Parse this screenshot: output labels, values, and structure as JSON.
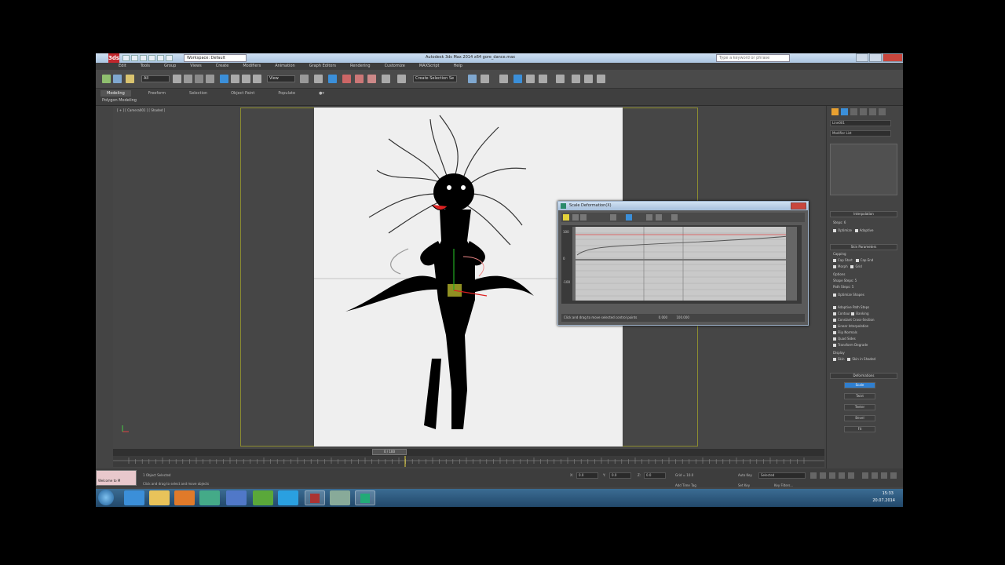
{
  "window": {
    "title": "Autodesk 3ds Max 2014 x64    gore_dance.max",
    "app_logo": "3ds",
    "workspace": "Workspace: Default",
    "search_placeholder": "Type a keyword or phrase"
  },
  "menus": [
    "Edit",
    "Tools",
    "Group",
    "Views",
    "Create",
    "Modifiers",
    "Animation",
    "Graph Editors",
    "Rendering",
    "Customize",
    "MAXScript",
    "Help"
  ],
  "toolbar": {
    "selection_filter": "All",
    "ref_coord": "View",
    "named_selection": "Create Selection Se"
  },
  "ribbon": {
    "tabs": [
      "Modeling",
      "Freeform",
      "Selection",
      "Object Paint",
      "Populate"
    ],
    "active_tab": "Modeling",
    "sub_label": "Polygon Modeling"
  },
  "viewport": {
    "label": "[ + ] [ Camera001 ] [ Shaded ]"
  },
  "dialog": {
    "title": "Scale Deformation(X)",
    "graph_ticks": [
      "100",
      "0",
      "-100"
    ],
    "status_text": "Click and drag to move selected control points",
    "status_value_1": "0.000",
    "status_value_2": "100.000"
  },
  "command_panel": {
    "object_name": "Line001",
    "modifier_list": "Modifier List",
    "rollout_interpolation": "Interpolation",
    "steps_label": "Steps:",
    "steps_value": "6",
    "optimize_label": "Optimize",
    "adaptive_label": "Adaptive",
    "path_steps_label": "Path Steps:",
    "rollout_skin": "Skin Parameters",
    "capping_label": "Capping",
    "cap_start": "Cap Start",
    "cap_end": "Cap End",
    "morph": "Morph",
    "grid": "Grid",
    "options_label": "Options",
    "shape_steps_label": "Shape Steps:",
    "shape_steps_value": "5",
    "path_steps2_label": "Path Steps:",
    "path_steps2_value": "5",
    "options": [
      "Optimize Shapes",
      "Adaptive Path Steps",
      "Contour",
      "Banking",
      "Constant Cross-Section",
      "Linear Interpolation",
      "Flip Normals",
      "Quad Sides",
      "Transform Degrade"
    ],
    "display_label": "Display",
    "skin": "Skin",
    "skin_shaded": "Skin in Shaded",
    "rollout_deform": "Deformations",
    "deform_buttons": [
      "Scale",
      "Twist",
      "Teeter",
      "Bevel",
      "Fit"
    ],
    "active_deform": "Scale"
  },
  "timeline": {
    "slider": "0 / 100"
  },
  "status": {
    "maxscript": "Welcome to M",
    "selection": "1 Object Selected",
    "prompt": "Click and drag to select and move objects",
    "x_label": "X:",
    "x_value": "0.0",
    "y_label": "Y:",
    "y_value": "0.0",
    "z_label": "Z:",
    "z_value": "0.0",
    "grid": "Grid = 10.0",
    "add_time_tag": "Add Time Tag",
    "auto_key": "Auto Key",
    "set_key": "Set Key",
    "key_filter": "Selected",
    "key_filters_btn": "Key Filters..."
  },
  "taskbar": {
    "apps": [
      "internet-explorer-icon",
      "file-explorer-icon",
      "media-player-icon",
      "chrome-icon",
      "save-icon",
      "utorrent-icon",
      "skype-icon",
      "filezilla-icon",
      "3dsmax-icon",
      "paint-icon",
      "photoshop-icon"
    ],
    "time": "15:33",
    "date": "20.07.2014"
  },
  "colors": {
    "accent_blue": "#2f7fd0",
    "safe_frame": "#8c8c30",
    "close_red": "#c9463d"
  }
}
